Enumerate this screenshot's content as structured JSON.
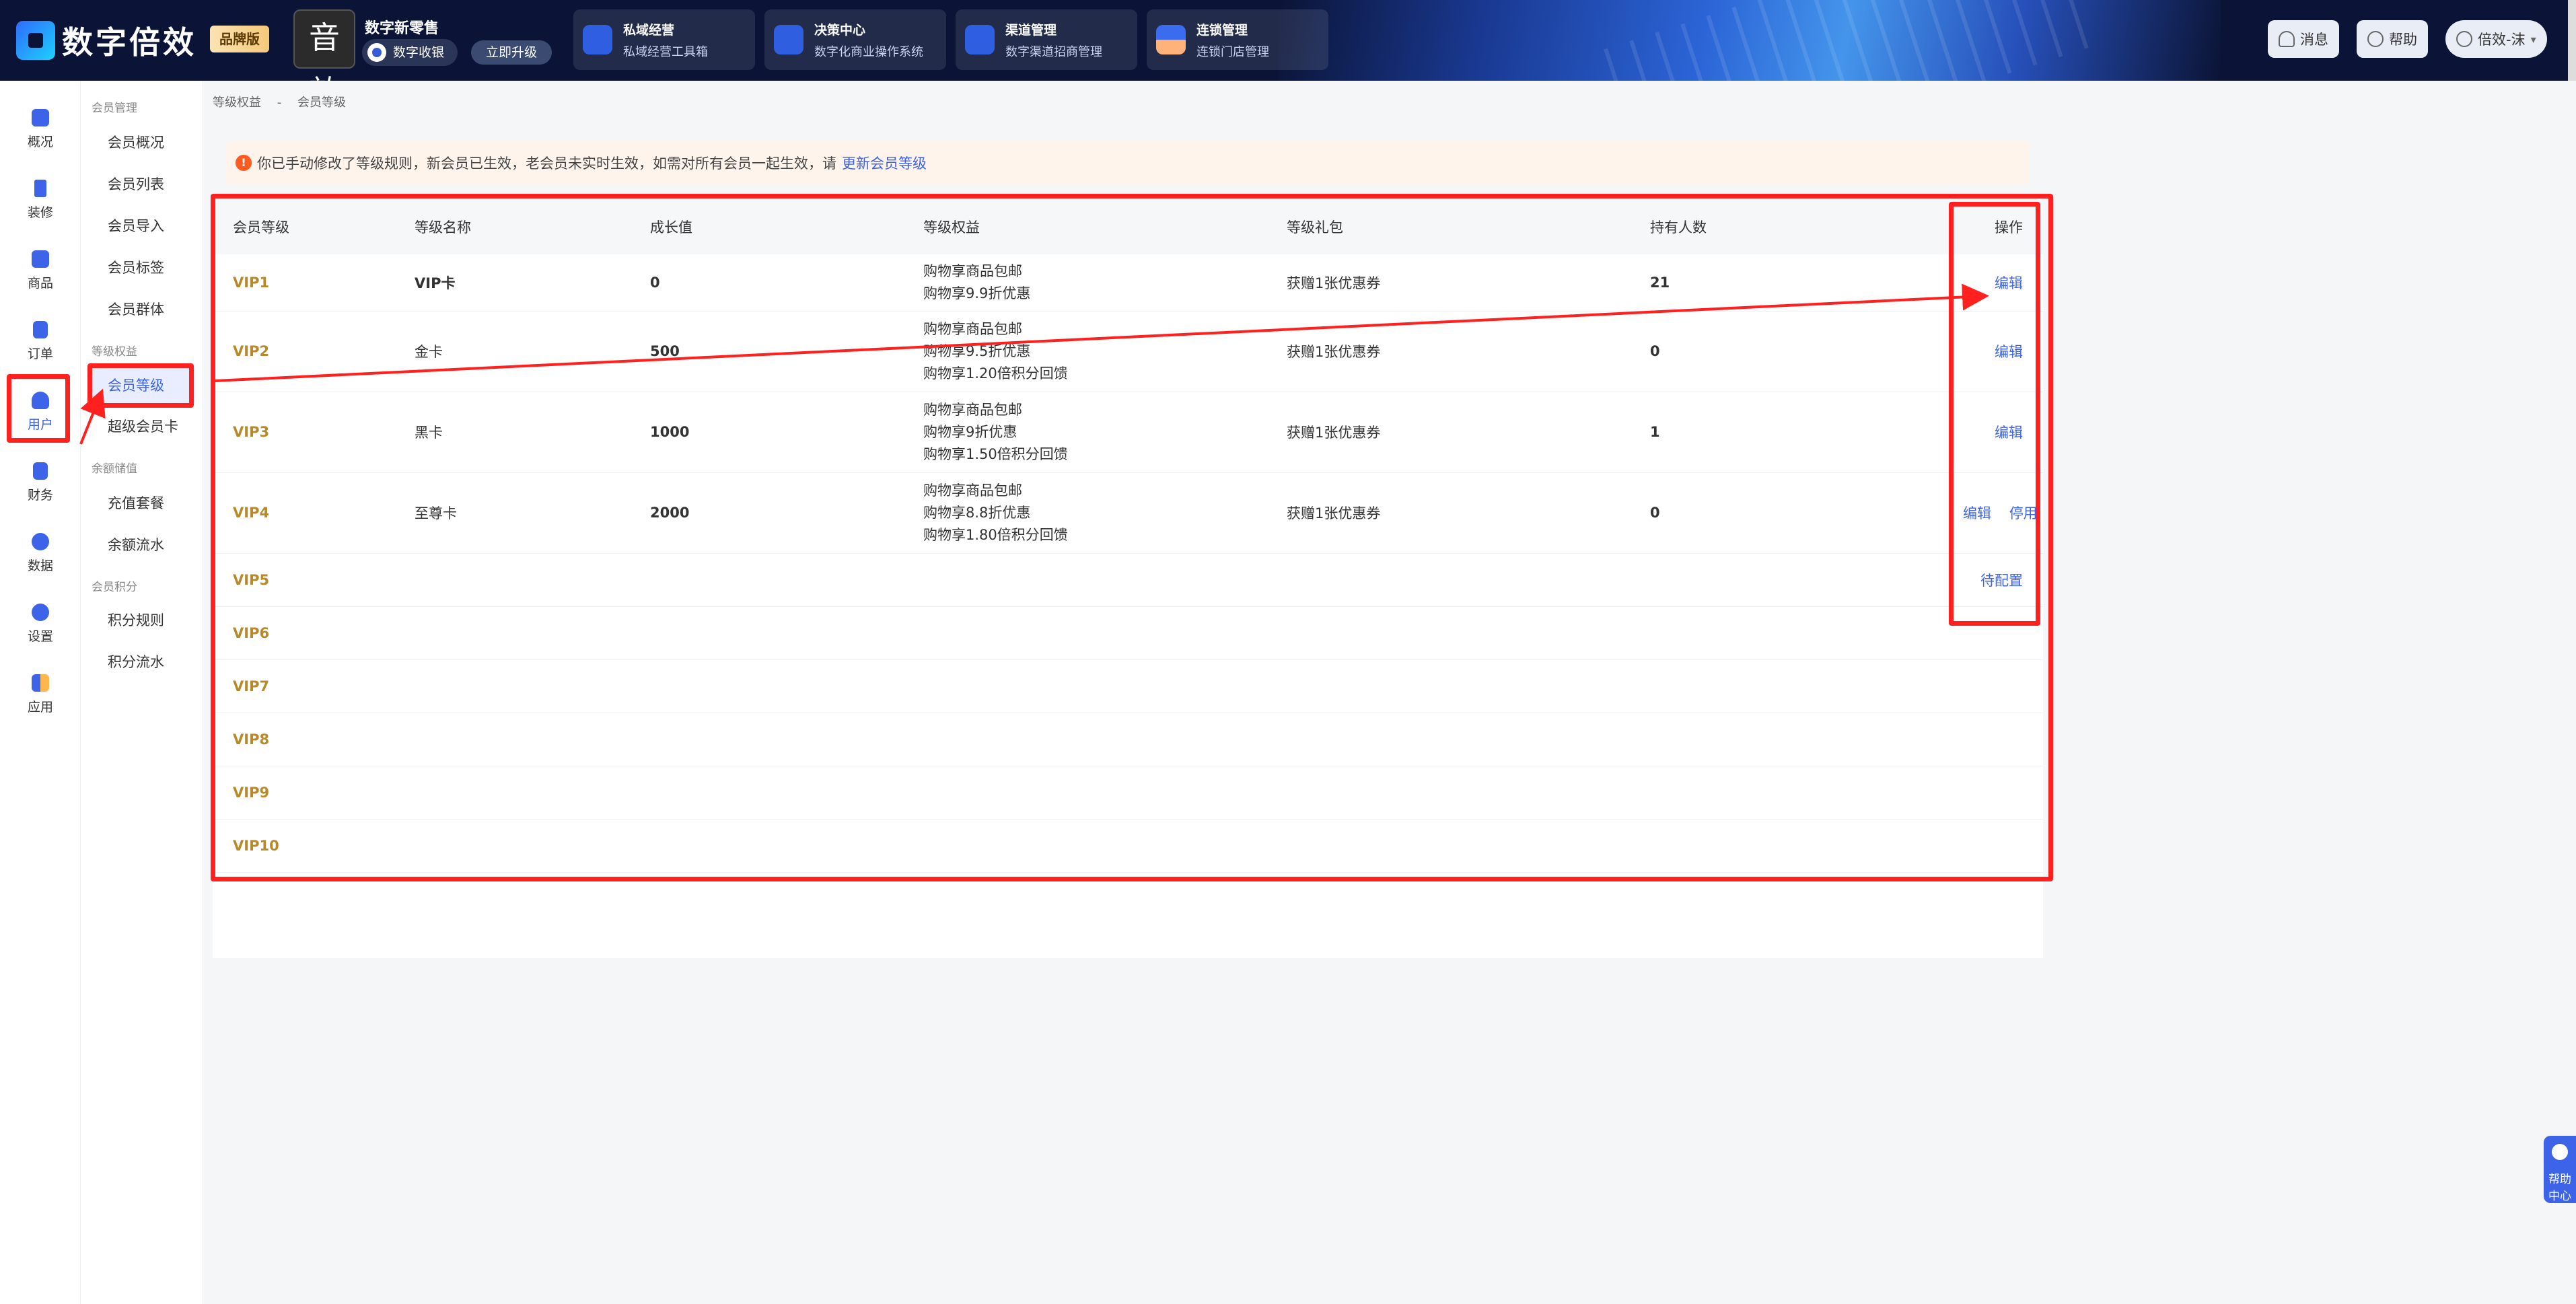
{
  "header": {
    "logo_text": "数字倍效",
    "brand_badge": "品牌版",
    "shop_avatar_text": "音效",
    "shop_name": "数字新零售",
    "shop_tag": "数字收银",
    "upgrade": "立即升级",
    "apps": [
      {
        "title": "私域经营",
        "subtitle": "私域经营工具箱"
      },
      {
        "title": "决策中心",
        "subtitle": "数字化商业操作系统"
      },
      {
        "title": "渠道管理",
        "subtitle": "数字渠道招商管理"
      },
      {
        "title": "连锁管理",
        "subtitle": "连锁门店管理"
      }
    ],
    "messages": "消息",
    "help": "帮助",
    "user": "倍效-沫"
  },
  "rail": [
    {
      "label": "概况",
      "icon": "chart-icon"
    },
    {
      "label": "装修",
      "icon": "brush-icon"
    },
    {
      "label": "商品",
      "icon": "goods-icon"
    },
    {
      "label": "订单",
      "icon": "order-icon"
    },
    {
      "label": "用户",
      "icon": "user-icon"
    },
    {
      "label": "财务",
      "icon": "finance-icon"
    },
    {
      "label": "数据",
      "icon": "pie-icon"
    },
    {
      "label": "设置",
      "icon": "gear-icon"
    },
    {
      "label": "应用",
      "icon": "apps-icon"
    }
  ],
  "subnav": {
    "groups": [
      "会员管理",
      "等级权益",
      "余额储值",
      "会员积分"
    ],
    "items": [
      "会员概况",
      "会员列表",
      "会员导入",
      "会员标签",
      "会员群体",
      "会员等级",
      "超级会员卡",
      "充值套餐",
      "余额流水",
      "积分规则",
      "积分流水"
    ]
  },
  "breadcrumb": [
    "等级权益",
    "-",
    "会员等级"
  ],
  "notice": {
    "text": "你已手动修改了等级规则，新会员已生效，老会员未实时生效，如需对所有会员一起生效，请",
    "link": "更新会员等级"
  },
  "table": {
    "headers": [
      "会员等级",
      "等级名称",
      "成长值",
      "等级权益",
      "等级礼包",
      "持有人数",
      "操作"
    ],
    "rows": [
      {
        "level": "VIP1",
        "name": "VIP卡",
        "growth": "0",
        "benefits": [
          "购物享商品包邮",
          "购物享9.9折优惠"
        ],
        "gift": "获赠1张优惠券",
        "count": "21",
        "ops": [
          "编辑"
        ]
      },
      {
        "level": "VIP2",
        "name": "金卡",
        "growth": "500",
        "benefits": [
          "购物享商品包邮",
          "购物享9.5折优惠",
          "购物享1.20倍积分回馈"
        ],
        "gift": "获赠1张优惠券",
        "count": "0",
        "ops": [
          "编辑"
        ]
      },
      {
        "level": "VIP3",
        "name": "黑卡",
        "growth": "1000",
        "benefits": [
          "购物享商品包邮",
          "购物享9折优惠",
          "购物享1.50倍积分回馈"
        ],
        "gift": "获赠1张优惠券",
        "count": "1",
        "ops": [
          "编辑"
        ]
      },
      {
        "level": "VIP4",
        "name": "至尊卡",
        "growth": "2000",
        "benefits": [
          "购物享商品包邮",
          "购物享8.8折优惠",
          "购物享1.80倍积分回馈"
        ],
        "gift": "获赠1张优惠券",
        "count": "0",
        "ops": [
          "编辑",
          "停用"
        ]
      },
      {
        "level": "VIP5",
        "name": "",
        "growth": "",
        "benefits": [],
        "gift": "",
        "count": "",
        "ops": [
          "待配置"
        ]
      },
      {
        "level": "VIP6",
        "name": "",
        "growth": "",
        "benefits": [],
        "gift": "",
        "count": "",
        "ops": []
      },
      {
        "level": "VIP7",
        "name": "",
        "growth": "",
        "benefits": [],
        "gift": "",
        "count": "",
        "ops": []
      },
      {
        "level": "VIP8",
        "name": "",
        "growth": "",
        "benefits": [],
        "gift": "",
        "count": "",
        "ops": []
      },
      {
        "level": "VIP9",
        "name": "",
        "growth": "",
        "benefits": [],
        "gift": "",
        "count": "",
        "ops": []
      },
      {
        "level": "VIP10",
        "name": "",
        "growth": "",
        "benefits": [],
        "gift": "",
        "count": "",
        "ops": []
      }
    ]
  },
  "help_float": "帮助中心",
  "colors": {
    "accent": "#3c63e8",
    "level_gold": "#b8892a",
    "annotation_red": "#ff2020",
    "notice_bg": "#fff4ec"
  }
}
